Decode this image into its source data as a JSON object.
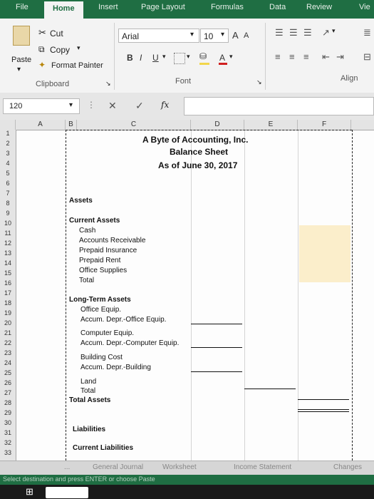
{
  "ribbon_tabs": [
    "File",
    "Home",
    "Insert",
    "Page Layout",
    "Formulas",
    "Data",
    "Review",
    "Vie"
  ],
  "clipboard": {
    "cut": "Cut",
    "copy": "Copy",
    "paste": "Paste",
    "format_painter": "Format Painter",
    "group_label": "Clipboard"
  },
  "font": {
    "name": "Arial",
    "size": "10",
    "grow": "A",
    "shrink": "A",
    "bold": "B",
    "italic": "I",
    "underline": "U",
    "font_color": "A",
    "group_label": "Font"
  },
  "alignment": {
    "group_label": "Align"
  },
  "formula_bar": {
    "name_box": "120",
    "cancel": "✕",
    "enter": "✓",
    "fx": "fx",
    "value": ""
  },
  "columns": [
    "A",
    "B",
    "C",
    "D",
    "E",
    "F"
  ],
  "rows": [
    "1",
    "2",
    "3",
    "4",
    "5",
    "6",
    "7",
    "8",
    "9",
    "10",
    "11",
    "12",
    "13",
    "14",
    "15",
    "16",
    "17",
    "18",
    "19",
    "20",
    "21",
    "22",
    "23",
    "24",
    "25",
    "26",
    "27",
    "28",
    "29",
    "30",
    "31",
    "32",
    "33"
  ],
  "sheet": {
    "title1": "A Byte of Accounting, Inc.",
    "title2": "Balance Sheet",
    "title3": "As of June 30, 2017",
    "assets": "Assets",
    "current_assets": "Current Assets",
    "cash": "Cash",
    "ar": "Accounts Receivable",
    "prepaid_ins": "Prepaid Insurance",
    "prepaid_rent": "Prepaid Rent",
    "office_supplies": "Office Supplies",
    "total1": "Total",
    "lt_assets": "Long-Term Assets",
    "office_equip": "Office Equip.",
    "accum_office": "Accum. Depr.-Office Equip.",
    "computer_equip": "Computer Equip.",
    "accum_computer": "Accum. Depr.-Computer Equip.",
    "building_cost": "Building Cost",
    "accum_building": "Accum. Depr.-Building",
    "land": "Land",
    "total2": "Total",
    "total_assets": "Total Assets",
    "liabilities": "Liabilities",
    "current_liabilities": "Current Liabilities"
  },
  "sheet_tabs": [
    "...",
    "General Journal",
    "Worksheet",
    "Income Statement",
    "Changes"
  ],
  "status_text": "Select destination and press ENTER or choose Paste",
  "colors": {
    "ribbon_green": "#1f6e43",
    "highlight": "#fbeecb"
  }
}
